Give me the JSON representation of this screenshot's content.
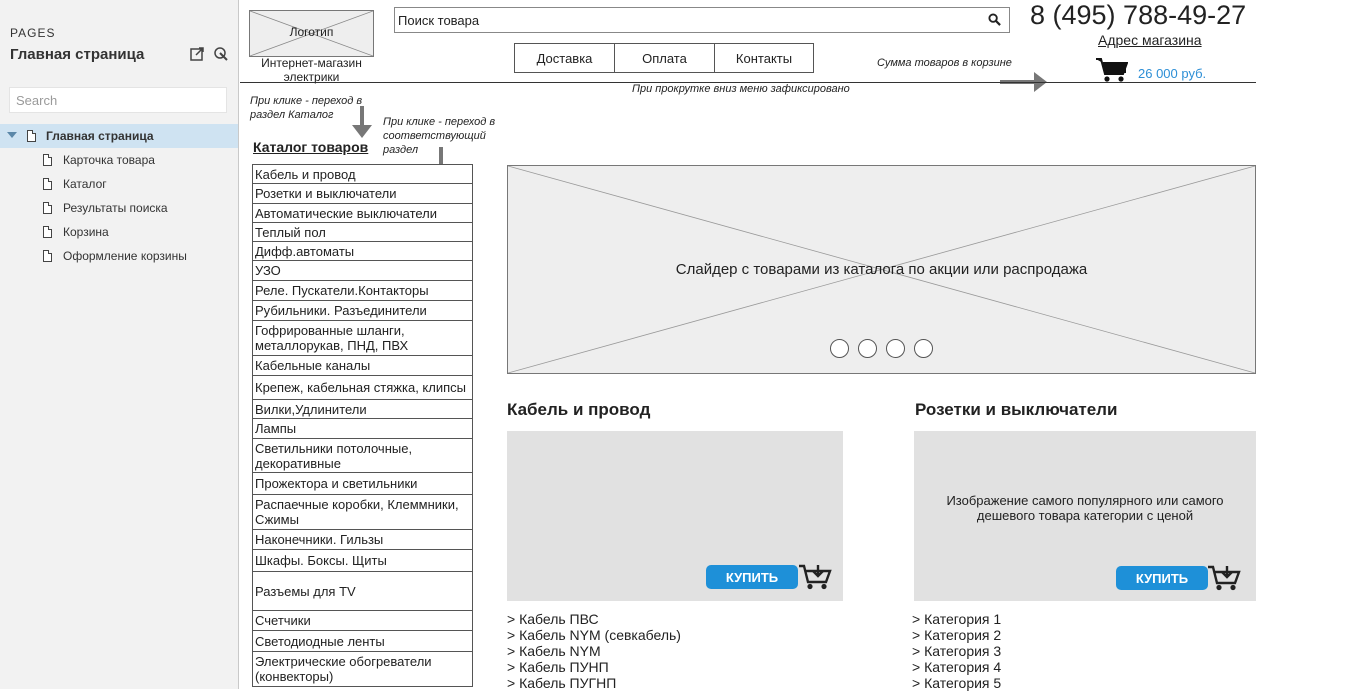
{
  "sidebar": {
    "heading": "PAGES",
    "title": "Главная страница",
    "search_placeholder": "Search",
    "pages": [
      {
        "label": "Главная страница"
      },
      {
        "label": "Карточка товара"
      },
      {
        "label": "Каталог"
      },
      {
        "label": "Результаты поиска"
      },
      {
        "label": "Корзина"
      },
      {
        "label": "Оформление корзины"
      }
    ]
  },
  "header": {
    "logo": "Логотип",
    "tagline_1": "Интернет-магазин",
    "tagline_2": "электрики",
    "search_value": "Поиск товара",
    "phone": "8 (495) 788-49-27",
    "address": "Адрес магазина",
    "nav": [
      "Доставка",
      "Оплата",
      "Контакты"
    ],
    "cart_note": "Сумма товаров в корзине",
    "cart_sum": "26 000 руб.",
    "scroll_note": "При прокрутке вниз меню зафиксировано"
  },
  "notes": {
    "catalog_1": "При клике - переход в",
    "catalog_2": "раздел Каталог",
    "section_1": "При клике - переход в",
    "section_2": "соответствующий",
    "section_3": "раздел"
  },
  "catalog": {
    "title": "Каталог товаров",
    "items": [
      "Кабель и провод",
      "Розетки и выключатели",
      "Автоматические выключатели",
      "Теплый пол",
      "Дифф.автоматы",
      "УЗО",
      "Реле. Пускатели.Контакторы",
      "Рубильники. Разъединители",
      "Гофрированные шланги, металлорукав, ПНД, ПВХ",
      "Кабельные каналы",
      "Крепеж, кабельная стяжка, клипсы",
      "Вилки,Удлинители",
      "Лампы",
      "Светильники потолочные, декоративные",
      "Прожектора и светильники",
      "Распаечные коробки, Клеммники, Сжимы",
      "Наконечники. Гильзы",
      "Шкафы. Боксы. Щиты",
      "Разъемы для TV",
      "Счетчики",
      "Светодиодные ленты",
      "Электрические обогреватели (конвекторы)"
    ]
  },
  "slider": {
    "text": "Слайдер с товарами из каталога по акции или распродажа",
    "dots": 4
  },
  "sections": [
    {
      "title": "Кабель и провод",
      "image_text": "",
      "buy_label": "КУПИТЬ",
      "links": [
        "> Кабель ПВС",
        "> Кабель NYM (севкабель)",
        "> Кабель NYM",
        "> Кабель ПУНП",
        "> Кабель ПУГНП"
      ]
    },
    {
      "title": "Розетки и выключатели",
      "image_text_1": "Изображение самого популярного или самого",
      "image_text_2": "дешевого товара категории с ценой",
      "buy_label": "КУПИТЬ",
      "links": [
        "> Категория 1",
        "> Категория 2",
        "> Категория 3",
        "> Категория 4",
        "> Категория 5"
      ]
    }
  ],
  "colors": {
    "accent": "#1e90d8",
    "sidebar_bg": "#f2f2f2",
    "selection": "#cfe3f2",
    "wire_gray": "#e1e1e1"
  }
}
